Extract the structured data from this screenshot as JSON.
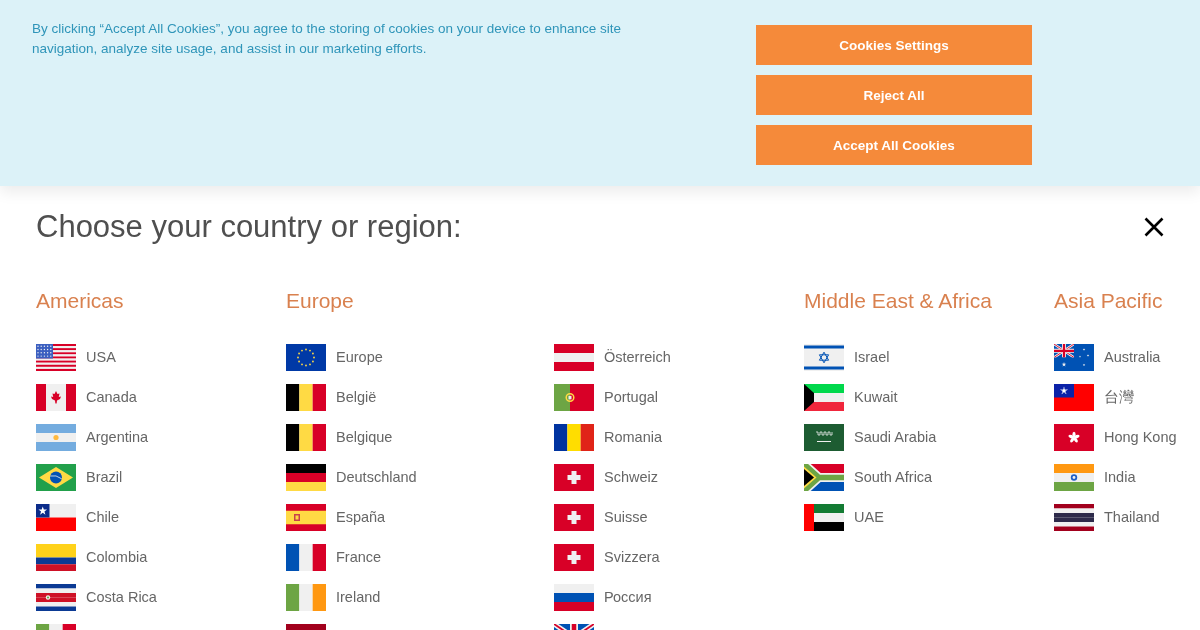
{
  "cookie_banner": {
    "message": "By clicking “Accept All Cookies”, you agree to the storing of cookies on your device to enhance site navigation, analyze site usage, and assist in our marketing efforts.",
    "buttons": [
      "Cookies Settings",
      "Reject All",
      "Accept All Cookies"
    ]
  },
  "dialog": {
    "title": "Choose your country or region:",
    "regions": [
      {
        "name": "Americas",
        "columns": [
          [
            {
              "kind": "us",
              "name": "USA"
            },
            {
              "kind": "ca",
              "name": "Canada"
            },
            {
              "kind": "ar",
              "name": "Argentina"
            },
            {
              "kind": "br",
              "name": "Brazil"
            },
            {
              "kind": "cl",
              "name": "Chile"
            },
            {
              "kind": "co",
              "name": "Colombia"
            },
            {
              "kind": "cr",
              "name": "Costa Rica"
            },
            {
              "kind": "mx"
            }
          ]
        ]
      },
      {
        "name": "Europe",
        "columns": [
          [
            {
              "kind": "eu",
              "name": "Europe"
            },
            {
              "kind": "be",
              "name": "België"
            },
            {
              "kind": "be",
              "name": "Belgique"
            },
            {
              "kind": "de",
              "name": "Deutschland"
            },
            {
              "kind": "es",
              "name": "España"
            },
            {
              "kind": "fr",
              "name": "France"
            },
            {
              "kind": "ie",
              "name": "Ireland"
            },
            {
              "kind": "nl"
            }
          ],
          [
            {
              "kind": "at",
              "name": "Österreich"
            },
            {
              "kind": "pt",
              "name": "Portugal"
            },
            {
              "kind": "ro",
              "name": "Romania"
            },
            {
              "kind": "ch",
              "name": "Schweiz"
            },
            {
              "kind": "ch",
              "name": "Suisse"
            },
            {
              "kind": "ch",
              "name": "Svizzera"
            },
            {
              "kind": "ru",
              "name": "Россия"
            },
            {
              "kind": "gb"
            }
          ]
        ]
      },
      {
        "name": "Middle East & Africa",
        "columns": [
          [
            {
              "kind": "il",
              "name": "Israel"
            },
            {
              "kind": "kw",
              "name": "Kuwait"
            },
            {
              "kind": "sa",
              "name": "Saudi Arabia"
            },
            {
              "kind": "za",
              "name": "South Africa"
            },
            {
              "kind": "ae",
              "name": "UAE"
            }
          ]
        ]
      },
      {
        "name": "Asia Pacific",
        "columns": [
          [
            {
              "kind": "au",
              "name": "Australia"
            },
            {
              "kind": "tw",
              "name": "台灣"
            },
            {
              "kind": "hk",
              "name": "Hong Kong"
            },
            {
              "kind": "in",
              "name": "India"
            },
            {
              "kind": "th",
              "name": "Thailand"
            }
          ]
        ]
      }
    ]
  }
}
